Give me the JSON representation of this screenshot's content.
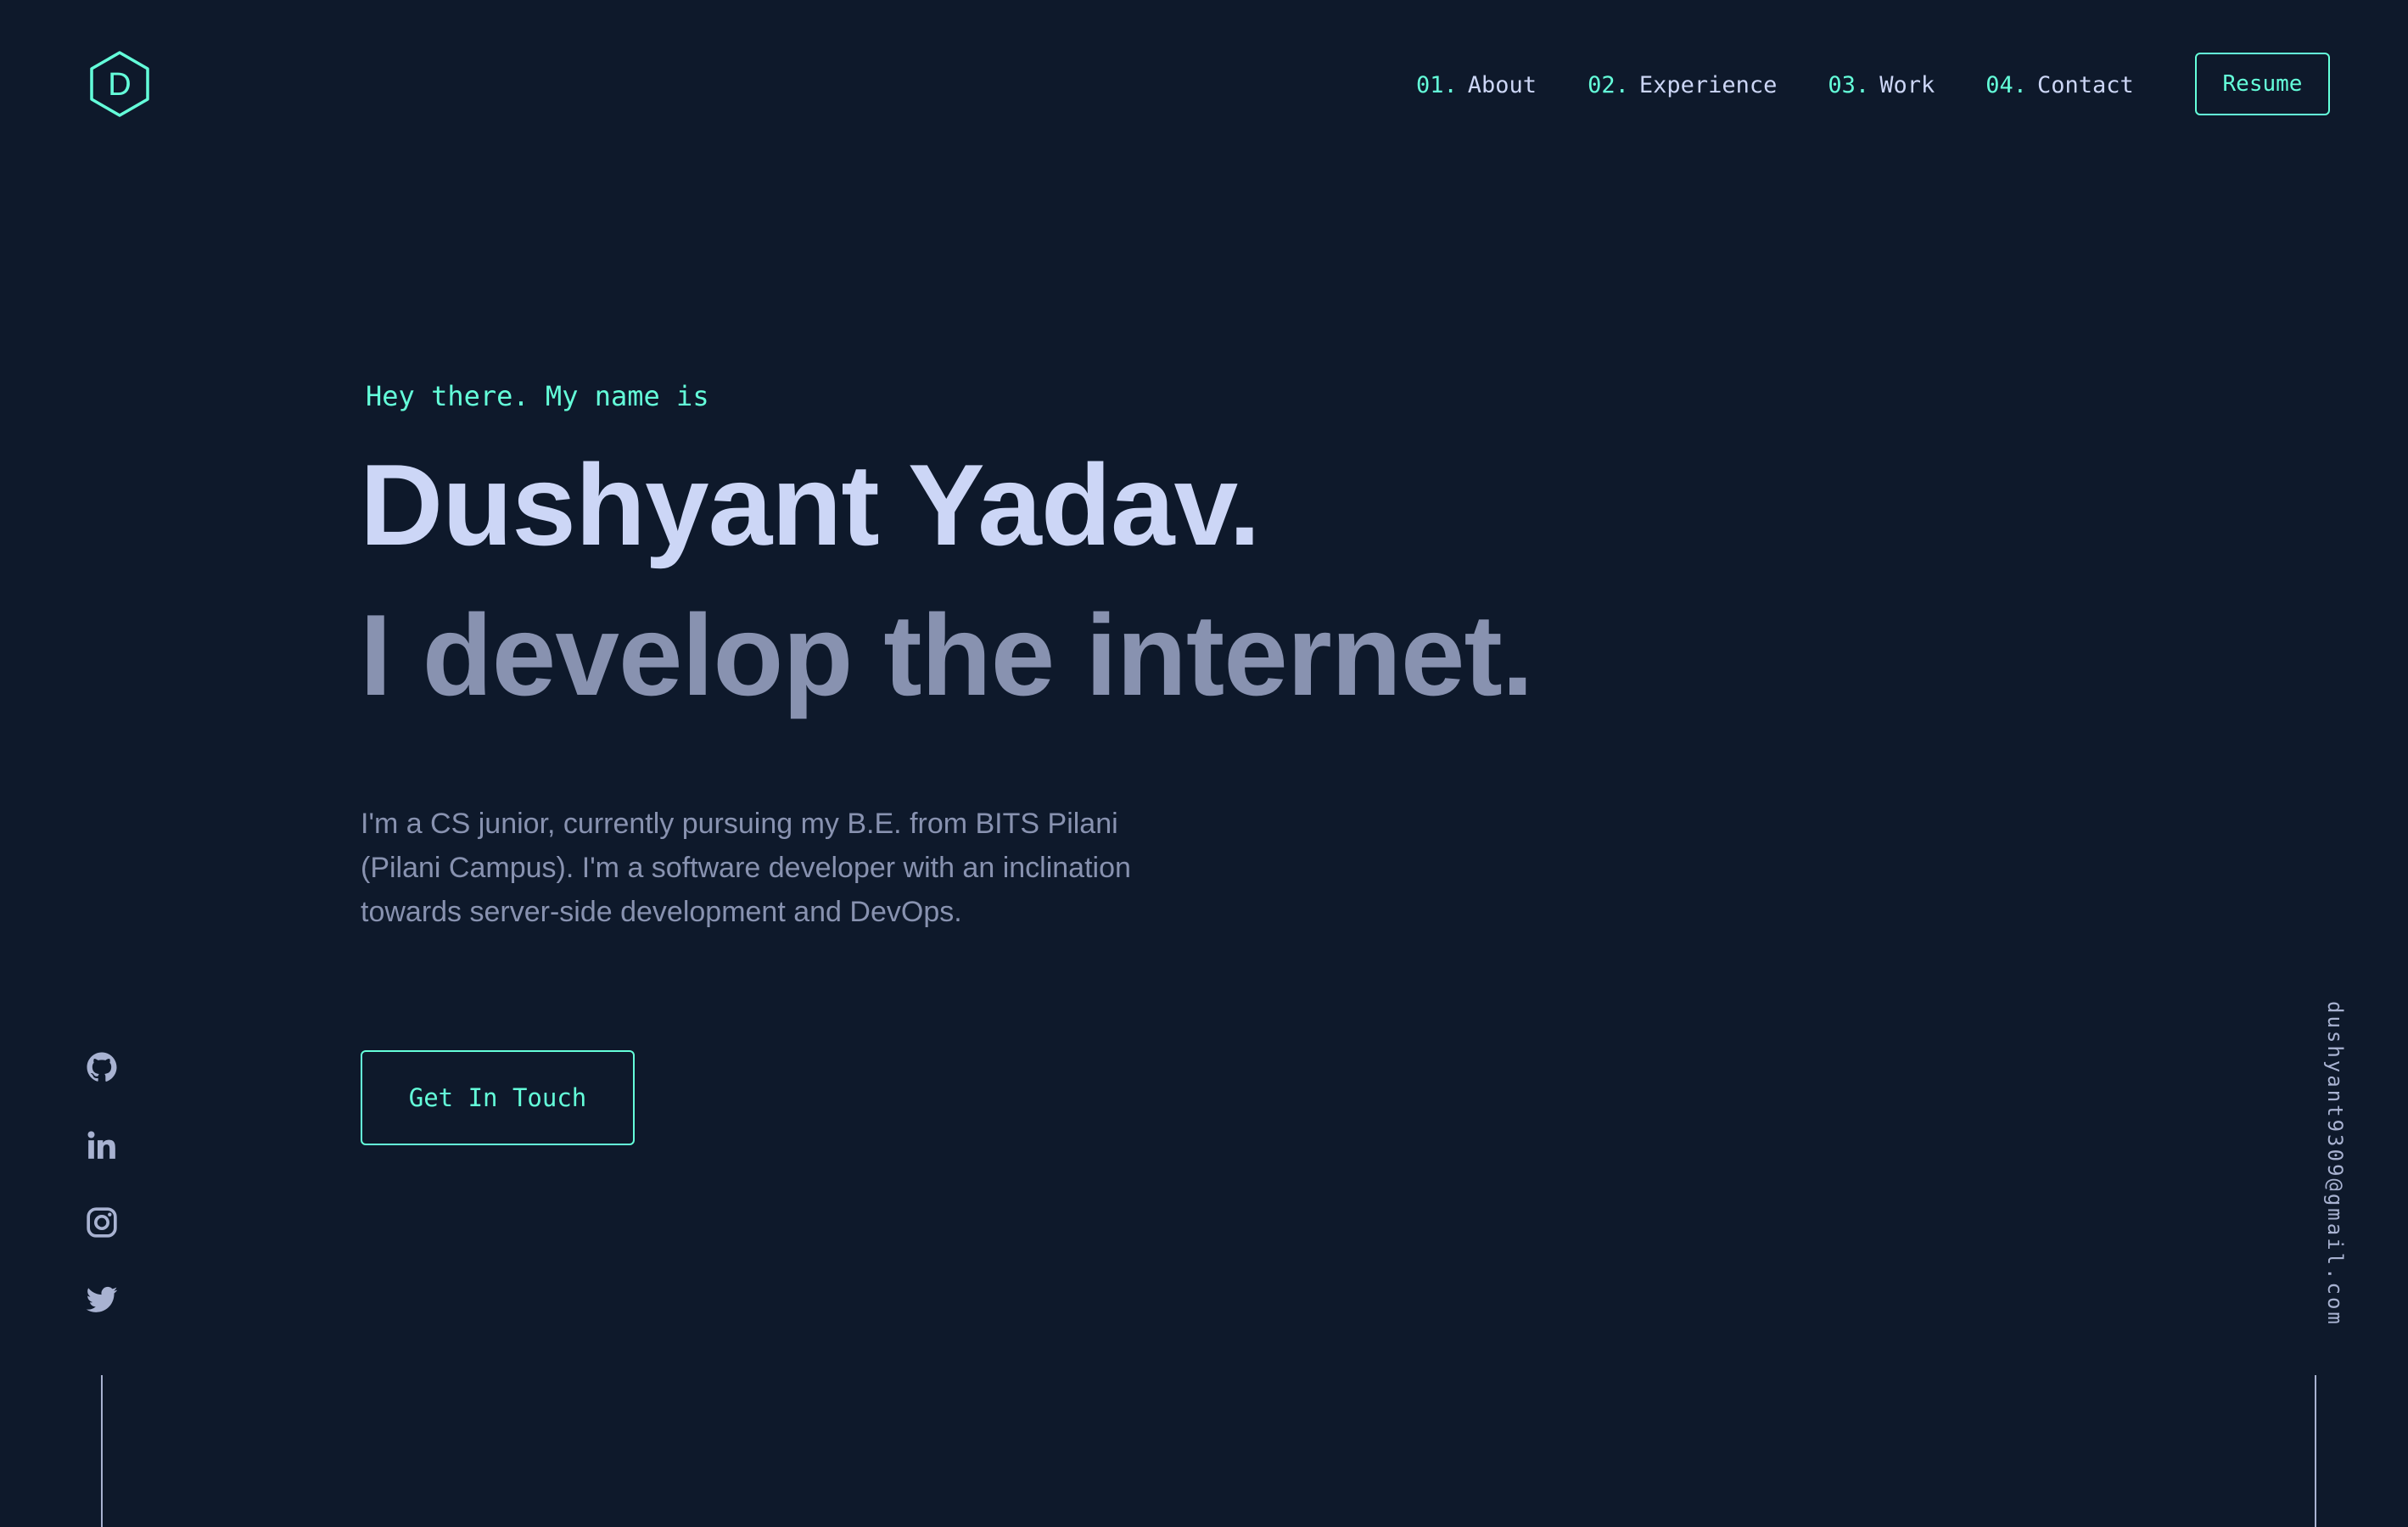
{
  "colors": {
    "background": "#0e192b",
    "accent": "#64ffda",
    "heading": "#ccd6f6",
    "text": "#8892b0",
    "light": "#a8b2d1"
  },
  "logo": {
    "letter": "D",
    "icon": "hexagon-logo-icon"
  },
  "nav": {
    "items": [
      {
        "num": "01.",
        "label": "About"
      },
      {
        "num": "02.",
        "label": "Experience"
      },
      {
        "num": "03.",
        "label": "Work"
      },
      {
        "num": "04.",
        "label": "Contact"
      }
    ],
    "resume_label": "Resume"
  },
  "hero": {
    "greeting": "Hey there. My name is",
    "name": "Dushyant Yadav.",
    "tagline": "I develop the internet.",
    "description": "I'm a CS junior, currently pursuing my B.E. from BITS Pilani (Pilani Campus). I'm a software developer with an inclination towards server-side development and DevOps.",
    "cta_label": "Get In Touch"
  },
  "social": {
    "icons": [
      "github-icon",
      "linkedin-icon",
      "instagram-icon",
      "twitter-icon"
    ]
  },
  "email": "dushyant9309@gmail.com"
}
